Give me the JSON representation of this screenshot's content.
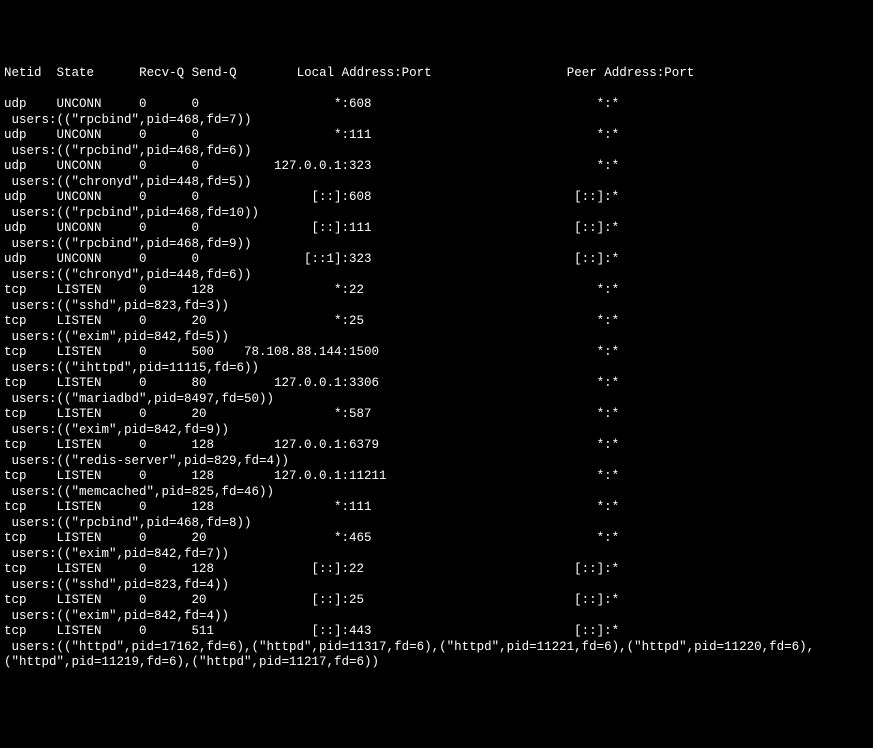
{
  "header": {
    "netid": "Netid",
    "state": "State",
    "recvq": "Recv-Q",
    "sendq": "Send-Q",
    "local": "Local Address:Port",
    "peer": "Peer Address:Port"
  },
  "rows": [
    {
      "main": "udp    UNCONN     0      0                  *:608                              *:*",
      "users": " users:((\"rpcbind\",pid=468,fd=7))"
    },
    {
      "main": "udp    UNCONN     0      0                  *:111                              *:*",
      "users": " users:((\"rpcbind\",pid=468,fd=6))"
    },
    {
      "main": "udp    UNCONN     0      0          127.0.0.1:323                              *:*",
      "users": " users:((\"chronyd\",pid=448,fd=5))"
    },
    {
      "main": "udp    UNCONN     0      0               [::]:608                           [::]:*",
      "users": " users:((\"rpcbind\",pid=468,fd=10))"
    },
    {
      "main": "udp    UNCONN     0      0               [::]:111                           [::]:*",
      "users": " users:((\"rpcbind\",pid=468,fd=9))"
    },
    {
      "main": "udp    UNCONN     0      0              [::1]:323                           [::]:*",
      "users": " users:((\"chronyd\",pid=448,fd=6))"
    },
    {
      "main": "tcp    LISTEN     0      128                *:22                               *:*",
      "users": " users:((\"sshd\",pid=823,fd=3))"
    },
    {
      "main": "tcp    LISTEN     0      20                 *:25                               *:*",
      "users": " users:((\"exim\",pid=842,fd=5))"
    },
    {
      "main": "tcp    LISTEN     0      500    78.108.88.144:1500                             *:*",
      "users": " users:((\"ihttpd\",pid=11115,fd=6))"
    },
    {
      "main": "tcp    LISTEN     0      80         127.0.0.1:3306                             *:*",
      "users": " users:((\"mariadbd\",pid=8497,fd=50))"
    },
    {
      "main": "tcp    LISTEN     0      20                 *:587                              *:*",
      "users": " users:((\"exim\",pid=842,fd=9))"
    },
    {
      "main": "tcp    LISTEN     0      128        127.0.0.1:6379                             *:*",
      "users": " users:((\"redis-server\",pid=829,fd=4))"
    },
    {
      "main": "tcp    LISTEN     0      128        127.0.0.1:11211                            *:*",
      "users": " users:((\"memcached\",pid=825,fd=46))"
    },
    {
      "main": "tcp    LISTEN     0      128                *:111                              *:*",
      "users": " users:((\"rpcbind\",pid=468,fd=8))"
    },
    {
      "main": "tcp    LISTEN     0      20                 *:465                              *:*",
      "users": " users:((\"exim\",pid=842,fd=7))"
    },
    {
      "main": "tcp    LISTEN     0      128             [::]:22                            [::]:*",
      "users": " users:((\"sshd\",pid=823,fd=4))"
    },
    {
      "main": "tcp    LISTEN     0      20              [::]:25                            [::]:*",
      "users": " users:((\"exim\",pid=842,fd=4))"
    },
    {
      "main": "tcp    LISTEN     0      511             [::]:443                           [::]:*",
      "users": " users:((\"httpd\",pid=17162,fd=6),(\"httpd\",pid=11317,fd=6),(\"httpd\",pid=11221,fd=6),(\"httpd\",pid=11220,fd=6),\n(\"httpd\",pid=11219,fd=6),(\"httpd\",pid=11217,fd=6))"
    }
  ]
}
